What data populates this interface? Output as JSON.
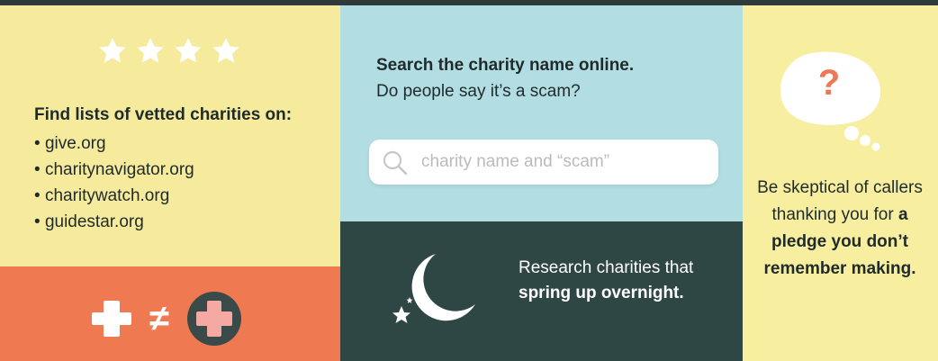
{
  "colors": {
    "yellow": "#f6ea9c",
    "orange": "#ef7a52",
    "light_blue": "#b2dde3",
    "dark_teal": "#2f4744",
    "accent": "#ee7756"
  },
  "left_panel": {
    "star_icon": "star-icon",
    "star_count": 4,
    "title": "Find lists of vetted charities on:",
    "items": [
      "give.org",
      "charitynavigator.org",
      "charitywatch.org",
      "guidestar.org"
    ]
  },
  "bottom_left": {
    "left_icon": "white-cross-icon",
    "symbol": "≠",
    "right_icon": "pink-cross-in-circle-icon"
  },
  "middle_top": {
    "line1": "Search the charity name online.",
    "line2": "Do people say it’s a scam?",
    "search_placeholder": "charity name and “scam”"
  },
  "middle_bottom": {
    "icon": "moon-and-stars-icon",
    "text_start": "Research charities that ",
    "text_bold": "spring up overnight."
  },
  "right_panel": {
    "icon": "thought-bubble-icon",
    "qmark": "?",
    "text_start": "Be skeptical of callers thanking you for ",
    "text_bold": "a pledge you don’t remember making."
  }
}
